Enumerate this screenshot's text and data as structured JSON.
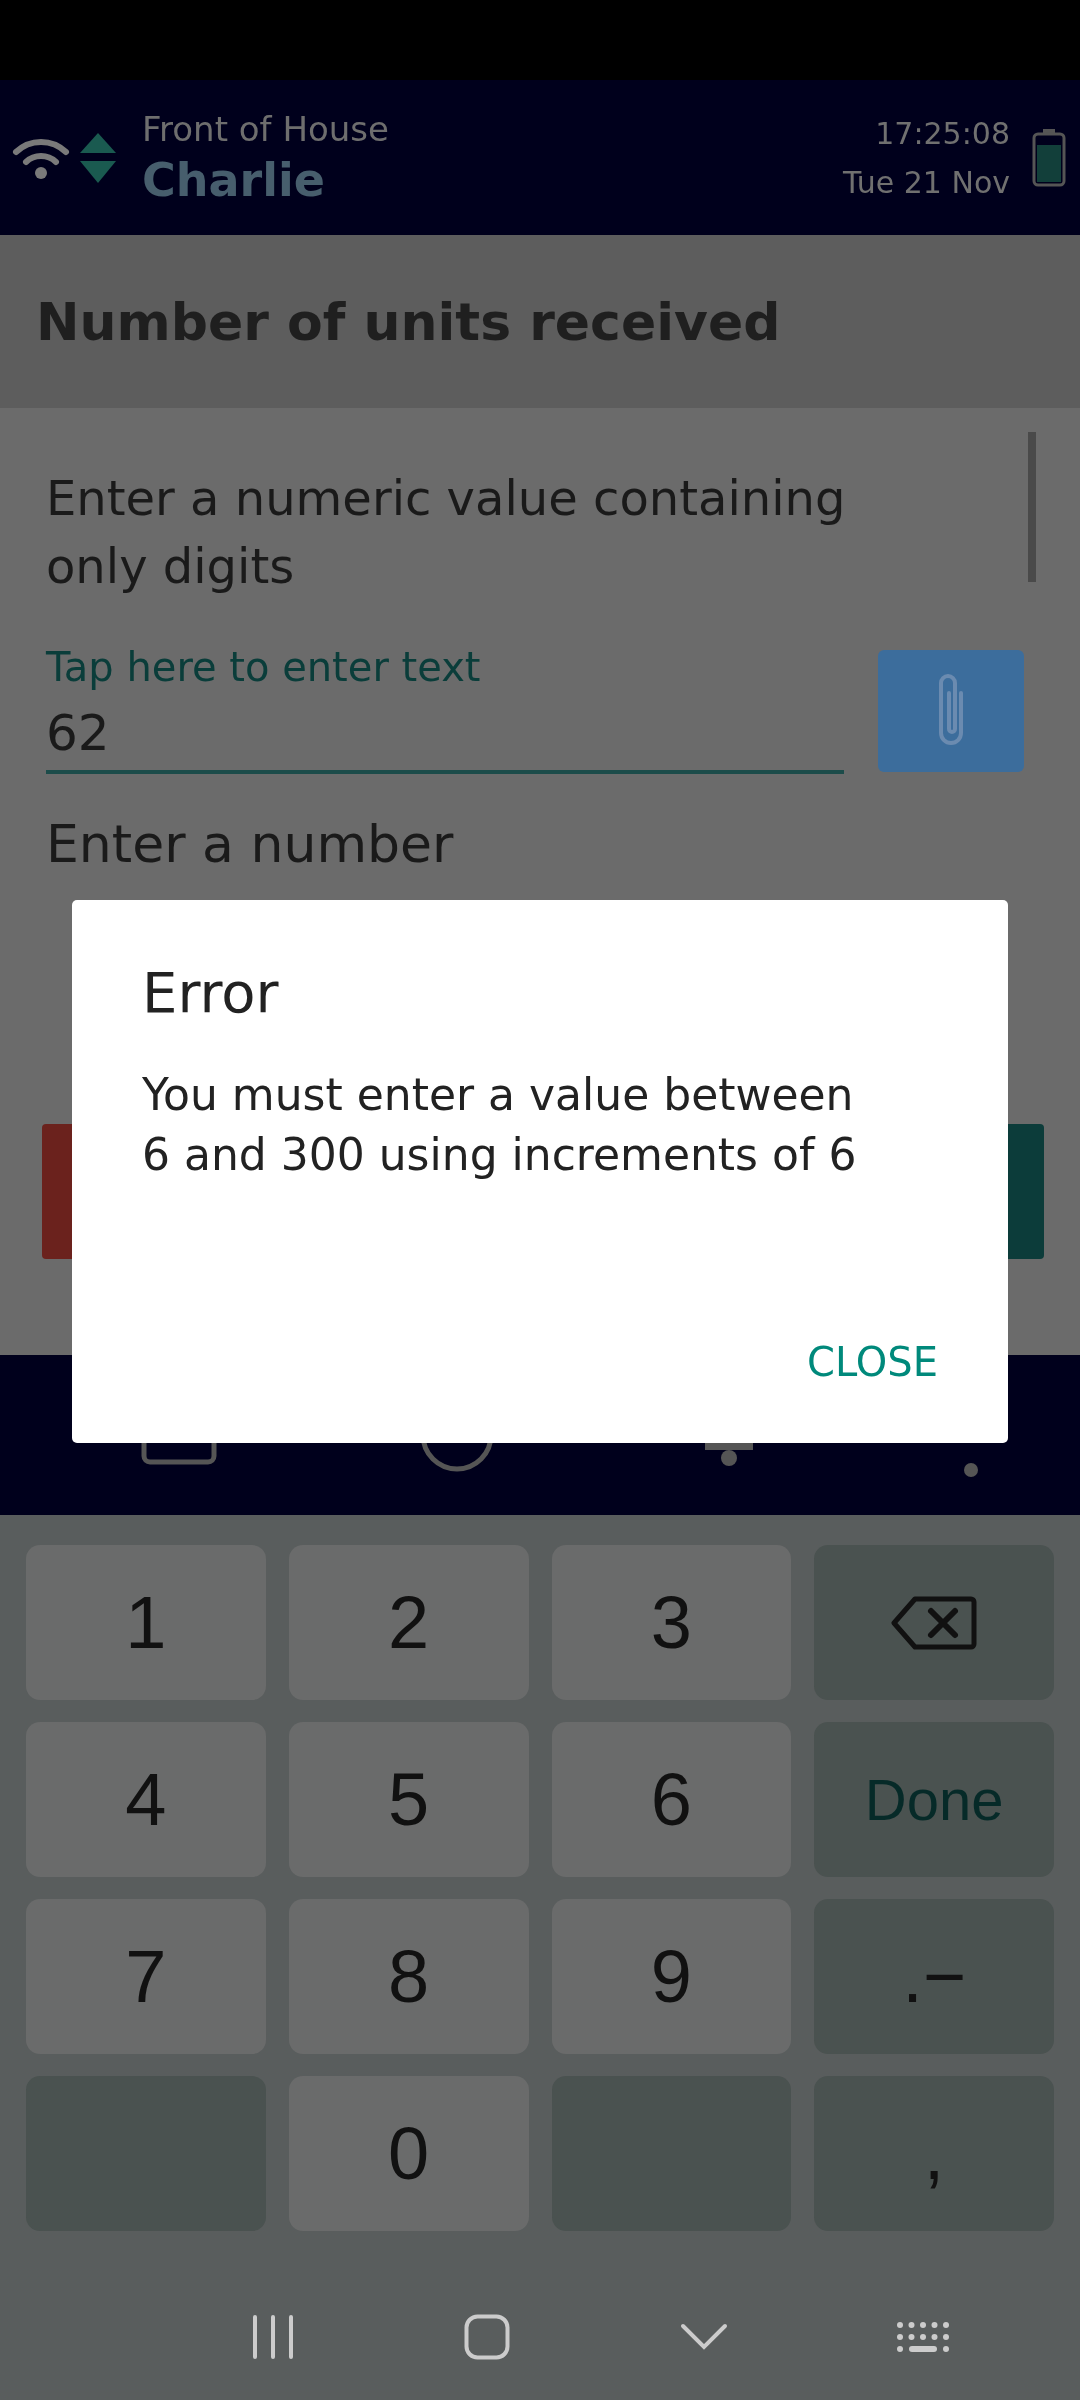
{
  "header": {
    "location": "Front of House",
    "user": "Charlie",
    "time": "17:25:08",
    "date": "Tue 21 Nov"
  },
  "page_title": "Number of units received",
  "question": {
    "prompt": "Enter a numeric value containing only digits",
    "label": "Tap here to enter text",
    "value": "62"
  },
  "next_question": {
    "prompt": "Enter a number"
  },
  "dialog": {
    "title": "Error",
    "message": "You must enter a value between 6 and 300 using increments of 6",
    "button": "CLOSE"
  },
  "keyboard": {
    "rows": [
      [
        {
          "kind": "digit",
          "label": "1"
        },
        {
          "kind": "digit",
          "label": "2"
        },
        {
          "kind": "digit",
          "label": "3"
        },
        {
          "kind": "backspace"
        }
      ],
      [
        {
          "kind": "digit",
          "label": "4"
        },
        {
          "kind": "digit",
          "label": "5"
        },
        {
          "kind": "digit",
          "label": "6"
        },
        {
          "kind": "done",
          "label": "Done"
        }
      ],
      [
        {
          "kind": "digit",
          "label": "7"
        },
        {
          "kind": "digit",
          "label": "8"
        },
        {
          "kind": "digit",
          "label": "9"
        },
        {
          "kind": "symbol",
          "label": ".−"
        }
      ],
      [
        {
          "kind": "blank"
        },
        {
          "kind": "digit",
          "label": "0"
        },
        {
          "kind": "blank"
        },
        {
          "kind": "symbol",
          "label": ","
        }
      ]
    ]
  }
}
